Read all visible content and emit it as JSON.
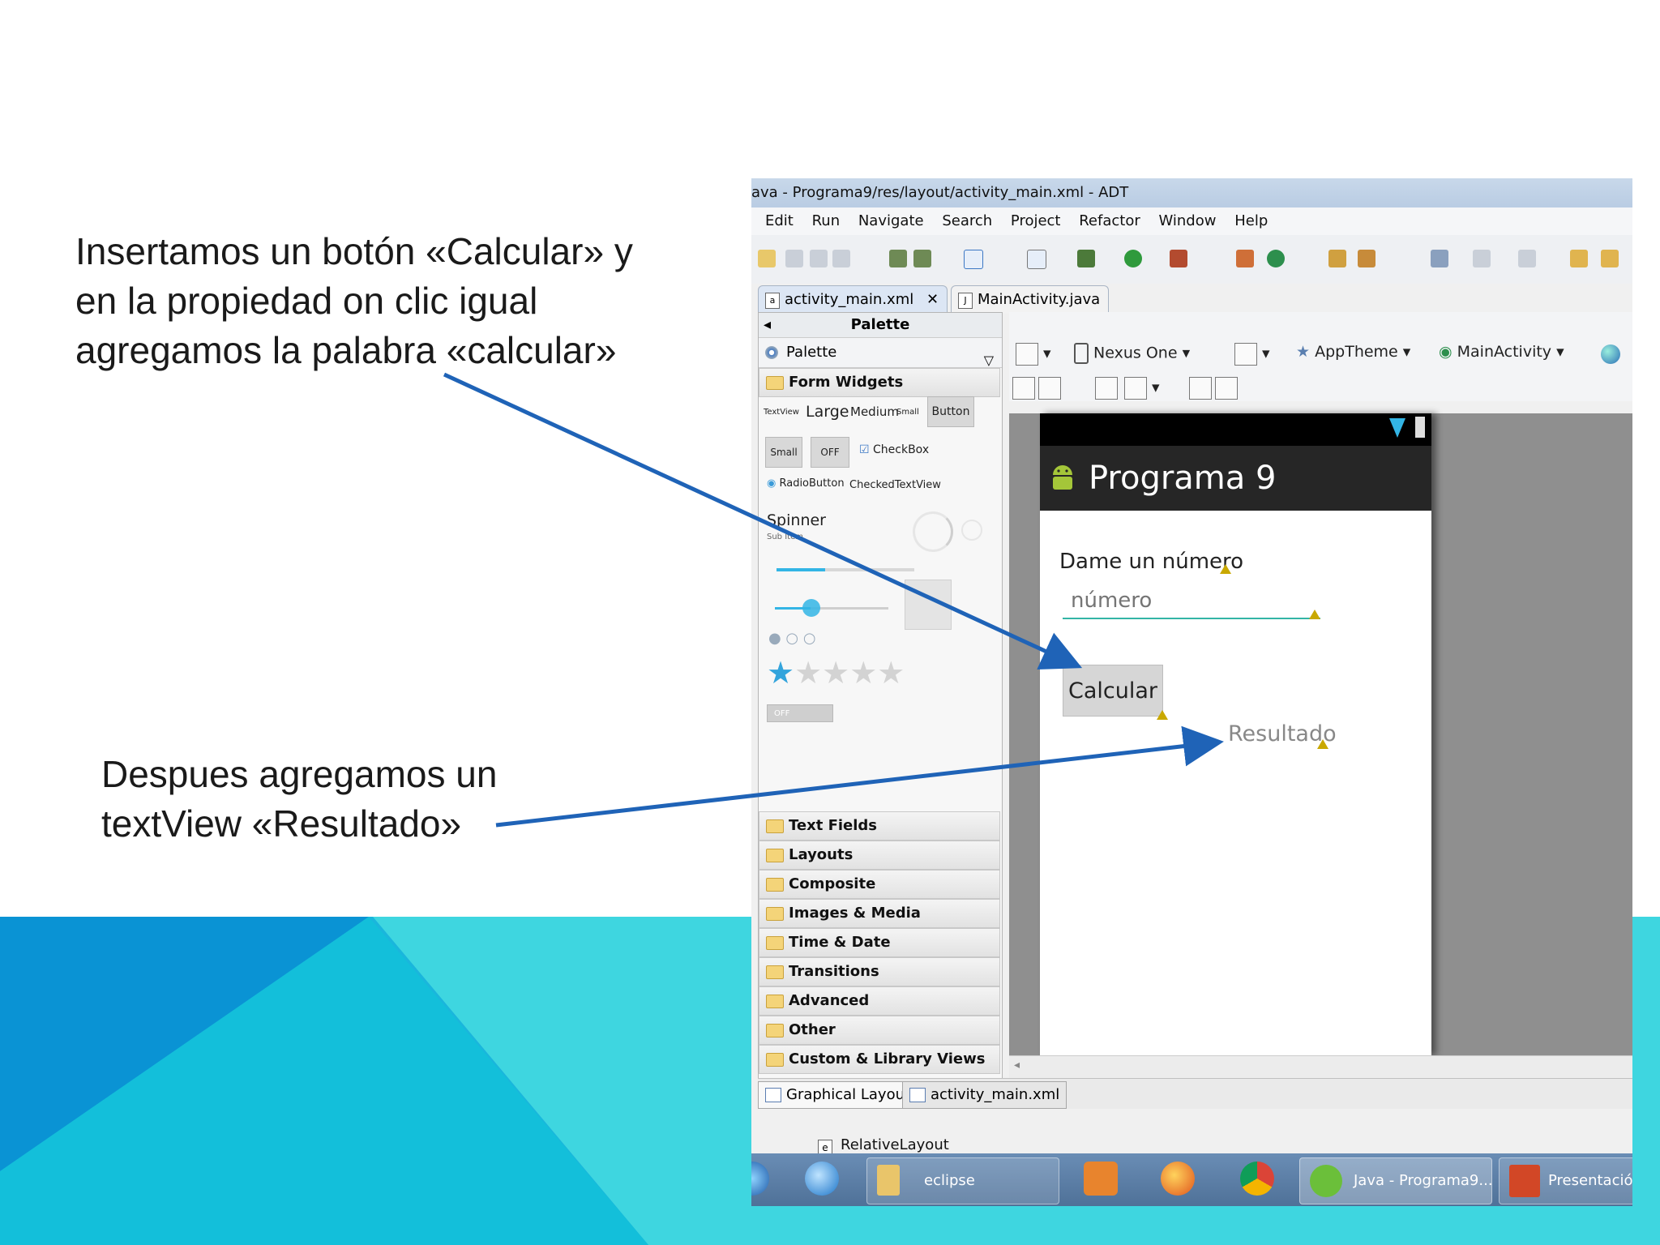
{
  "slide": {
    "caption_top": "Insertamos un botón «Calcular» y en la propiedad on clic igual agregamos la palabra «calcular»",
    "caption_bottom": "Despues agregamos un textView «Resultado»",
    "colors": {
      "cyan": "#3ed6e0",
      "blue": "#0a93d4",
      "arrow": "#1f63b7"
    }
  },
  "ide": {
    "window_title": "ava - Programa9/res/layout/activity_main.xml - ADT",
    "menu": [
      "Edit",
      "Run",
      "Navigate",
      "Search",
      "Project",
      "Refactor",
      "Window",
      "Help"
    ],
    "editor_tabs": [
      "activity_main.xml",
      "MainActivity.java"
    ],
    "palette": {
      "header": "Palette",
      "dropdown": "Palette",
      "open_category": "Form Widgets",
      "widgets": {
        "textview": "TextView",
        "large": "Large",
        "medium": "Medium",
        "small_text": "Small",
        "button": "Button",
        "small_button": "Small",
        "toggle": "OFF",
        "checkbox": "CheckBox",
        "radio": "RadioButton",
        "checked_text": "CheckedTextView",
        "spinner": "Spinner",
        "spinner_sub": "Sub Item",
        "switch": "OFF"
      },
      "categories": [
        "Text Fields",
        "Layouts",
        "Composite",
        "Images & Media",
        "Time & Date",
        "Transitions",
        "Advanced",
        "Other",
        "Custom & Library Views"
      ]
    },
    "canvas_toolbar": {
      "device": "Nexus One",
      "theme": "AppTheme",
      "activity": "MainActivity"
    },
    "phone": {
      "app_title": "Programa 9",
      "label": "Dame un número",
      "input_placeholder": "número",
      "button": "Calcular",
      "result": "Resultado"
    },
    "bottom_tabs": [
      "Graphical Layout",
      "activity_main.xml"
    ],
    "outline_item": "RelativeLayout",
    "taskbar": {
      "eclipse": "eclipse",
      "java": "Java - Programa9...",
      "presentation": "Presentació"
    }
  }
}
